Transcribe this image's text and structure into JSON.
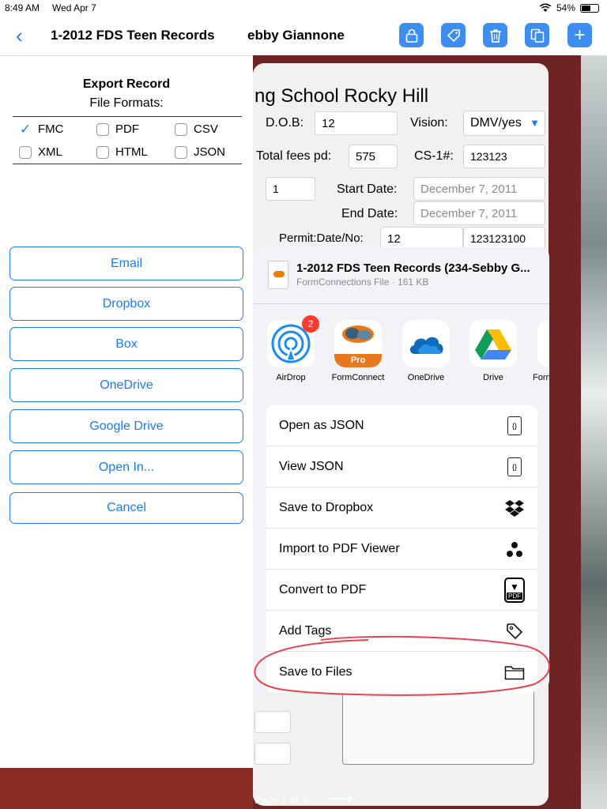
{
  "status_bar": {
    "time": "8:49 AM",
    "date": "Wed Apr 7",
    "battery": "54%"
  },
  "header": {
    "title_fragment": "ebby Giannone"
  },
  "toolbar": [
    "lock-icon",
    "tag-icon",
    "trash-icon",
    "duplicate-icon",
    "plus-icon"
  ],
  "form": {
    "heading": "ng School Rocky Hill",
    "dob_label": "D.O.B:",
    "dob_value": "12",
    "vision_label": "Vision:",
    "vision_value": "DMV/yes",
    "total_fees_label": "Total fees pd:",
    "total_fees_value": "575",
    "cs1_label": "CS-1#:",
    "cs1_value": "123123",
    "unlabeled_value": "1",
    "start_date_label": "Start Date:",
    "start_date_value": "December 7, 2011",
    "end_date_label": "End Date:",
    "end_date_value": "December 7, 2011",
    "permit_label": "Permit:Date/No:",
    "permit_date_value": "12",
    "permit_no_value": "123123100",
    "page_indicator": "Page 1 of 3"
  },
  "export_panel": {
    "title": "1-2012 FDS Teen Records",
    "export_title": "Export Record",
    "formats_label": "File Formats:",
    "formats": [
      {
        "label": "FMC",
        "checked": true
      },
      {
        "label": "PDF",
        "checked": false
      },
      {
        "label": "CSV",
        "checked": false
      },
      {
        "label": "XML",
        "checked": false
      },
      {
        "label": "HTML",
        "checked": false
      },
      {
        "label": "JSON",
        "checked": false
      }
    ],
    "buttons": [
      "Email",
      "Dropbox",
      "Box",
      "OneDrive",
      "Google Drive",
      "Open In...",
      "Cancel"
    ]
  },
  "share_sheet": {
    "file_name": "1-2012 FDS Teen Records (234-Sebby G...",
    "file_subtitle": "FormConnections File · 161 KB",
    "apps": [
      {
        "label": "AirDrop",
        "icon": "airdrop-icon",
        "badge": "2"
      },
      {
        "label": "FormConnect",
        "icon": "formconnect-icon",
        "tag": "Pro"
      },
      {
        "label": "OneDrive",
        "icon": "onedrive-icon"
      },
      {
        "label": "Drive",
        "icon": "google-drive-icon"
      },
      {
        "label": "Forn",
        "icon": "formconnect-icon"
      }
    ],
    "actions": [
      {
        "label": "Open as JSON",
        "icon": "json-file-icon"
      },
      {
        "label": "View JSON",
        "icon": "json-file-icon"
      },
      {
        "label": "Save to Dropbox",
        "icon": "dropbox-icon"
      },
      {
        "label": "Import to PDF Viewer",
        "icon": "pdf-viewer-icon"
      },
      {
        "label": "Convert to PDF",
        "icon": "pdf-icon"
      },
      {
        "label": "Add Tags",
        "icon": "tag-icon"
      },
      {
        "label": "Save to Files",
        "icon": "folder-icon"
      }
    ]
  },
  "colors": {
    "accent": "#1b7cf2",
    "annotation": "#e8444f",
    "badge": "#ff3b30"
  }
}
